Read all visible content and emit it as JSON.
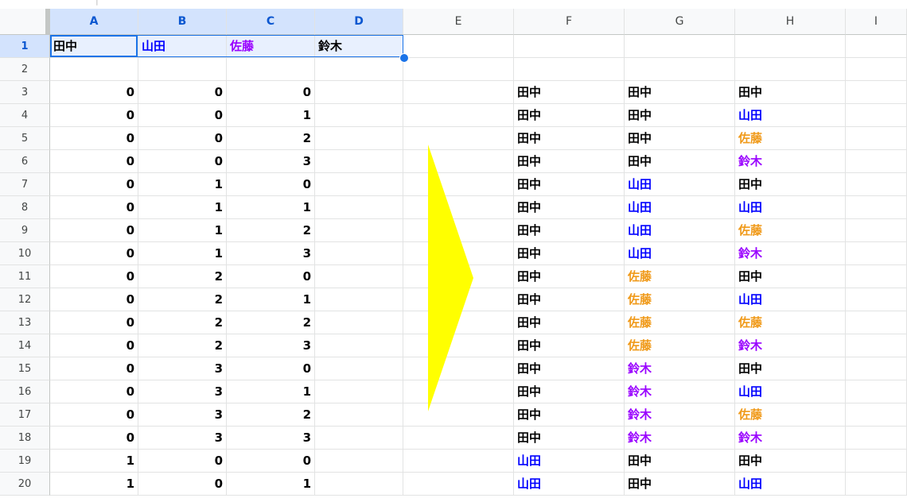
{
  "top_fragment": "|",
  "columns": [
    "A",
    "B",
    "C",
    "D",
    "E",
    "F",
    "G",
    "H",
    "I"
  ],
  "selected_columns": [
    "A",
    "B",
    "C",
    "D"
  ],
  "colors": {
    "black": "#000000",
    "blue": "#0000ff",
    "orange": "#f09a1a",
    "purple": "#9900ff",
    "arrow": "#ffff00",
    "selection": "#1a73e8"
  },
  "rows": [
    {
      "n": "1",
      "A": {
        "t": "田中",
        "c": "black"
      },
      "B": {
        "t": "山田",
        "c": "blue"
      },
      "C": {
        "t": "佐藤",
        "c": "purple"
      },
      "D": {
        "t": "鈴木",
        "c": "black"
      }
    },
    {
      "n": "2"
    },
    {
      "n": "3",
      "A": "0",
      "B": "0",
      "C": "0",
      "F": {
        "t": "田中",
        "c": "black"
      },
      "G": {
        "t": "田中",
        "c": "black"
      },
      "H": {
        "t": "田中",
        "c": "black"
      }
    },
    {
      "n": "4",
      "A": "0",
      "B": "0",
      "C": "1",
      "F": {
        "t": "田中",
        "c": "black"
      },
      "G": {
        "t": "田中",
        "c": "black"
      },
      "H": {
        "t": "山田",
        "c": "blue"
      }
    },
    {
      "n": "5",
      "A": "0",
      "B": "0",
      "C": "2",
      "F": {
        "t": "田中",
        "c": "black"
      },
      "G": {
        "t": "田中",
        "c": "black"
      },
      "H": {
        "t": "佐藤",
        "c": "orange"
      }
    },
    {
      "n": "6",
      "A": "0",
      "B": "0",
      "C": "3",
      "F": {
        "t": "田中",
        "c": "black"
      },
      "G": {
        "t": "田中",
        "c": "black"
      },
      "H": {
        "t": "鈴木",
        "c": "purple"
      }
    },
    {
      "n": "7",
      "A": "0",
      "B": "1",
      "C": "0",
      "F": {
        "t": "田中",
        "c": "black"
      },
      "G": {
        "t": "山田",
        "c": "blue"
      },
      "H": {
        "t": "田中",
        "c": "black"
      }
    },
    {
      "n": "8",
      "A": "0",
      "B": "1",
      "C": "1",
      "F": {
        "t": "田中",
        "c": "black"
      },
      "G": {
        "t": "山田",
        "c": "blue"
      },
      "H": {
        "t": "山田",
        "c": "blue"
      }
    },
    {
      "n": "9",
      "A": "0",
      "B": "1",
      "C": "2",
      "F": {
        "t": "田中",
        "c": "black"
      },
      "G": {
        "t": "山田",
        "c": "blue"
      },
      "H": {
        "t": "佐藤",
        "c": "orange"
      }
    },
    {
      "n": "10",
      "A": "0",
      "B": "1",
      "C": "3",
      "F": {
        "t": "田中",
        "c": "black"
      },
      "G": {
        "t": "山田",
        "c": "blue"
      },
      "H": {
        "t": "鈴木",
        "c": "purple"
      }
    },
    {
      "n": "11",
      "A": "0",
      "B": "2",
      "C": "0",
      "F": {
        "t": "田中",
        "c": "black"
      },
      "G": {
        "t": "佐藤",
        "c": "orange"
      },
      "H": {
        "t": "田中",
        "c": "black"
      }
    },
    {
      "n": "12",
      "A": "0",
      "B": "2",
      "C": "1",
      "F": {
        "t": "田中",
        "c": "black"
      },
      "G": {
        "t": "佐藤",
        "c": "orange"
      },
      "H": {
        "t": "山田",
        "c": "blue"
      }
    },
    {
      "n": "13",
      "A": "0",
      "B": "2",
      "C": "2",
      "F": {
        "t": "田中",
        "c": "black"
      },
      "G": {
        "t": "佐藤",
        "c": "orange"
      },
      "H": {
        "t": "佐藤",
        "c": "orange"
      }
    },
    {
      "n": "14",
      "A": "0",
      "B": "2",
      "C": "3",
      "F": {
        "t": "田中",
        "c": "black"
      },
      "G": {
        "t": "佐藤",
        "c": "orange"
      },
      "H": {
        "t": "鈴木",
        "c": "purple"
      }
    },
    {
      "n": "15",
      "A": "0",
      "B": "3",
      "C": "0",
      "F": {
        "t": "田中",
        "c": "black"
      },
      "G": {
        "t": "鈴木",
        "c": "purple"
      },
      "H": {
        "t": "田中",
        "c": "black"
      }
    },
    {
      "n": "16",
      "A": "0",
      "B": "3",
      "C": "1",
      "F": {
        "t": "田中",
        "c": "black"
      },
      "G": {
        "t": "鈴木",
        "c": "purple"
      },
      "H": {
        "t": "山田",
        "c": "blue"
      }
    },
    {
      "n": "17",
      "A": "0",
      "B": "3",
      "C": "2",
      "F": {
        "t": "田中",
        "c": "black"
      },
      "G": {
        "t": "鈴木",
        "c": "purple"
      },
      "H": {
        "t": "佐藤",
        "c": "orange"
      }
    },
    {
      "n": "18",
      "A": "0",
      "B": "3",
      "C": "3",
      "F": {
        "t": "田中",
        "c": "black"
      },
      "G": {
        "t": "鈴木",
        "c": "purple"
      },
      "H": {
        "t": "鈴木",
        "c": "purple"
      }
    },
    {
      "n": "19",
      "A": "1",
      "B": "0",
      "C": "0",
      "F": {
        "t": "山田",
        "c": "blue"
      },
      "G": {
        "t": "田中",
        "c": "black"
      },
      "H": {
        "t": "田中",
        "c": "black"
      }
    },
    {
      "n": "20",
      "A": "1",
      "B": "0",
      "C": "1",
      "F": {
        "t": "山田",
        "c": "blue"
      },
      "G": {
        "t": "田中",
        "c": "black"
      },
      "H": {
        "t": "山田",
        "c": "blue"
      }
    }
  ]
}
